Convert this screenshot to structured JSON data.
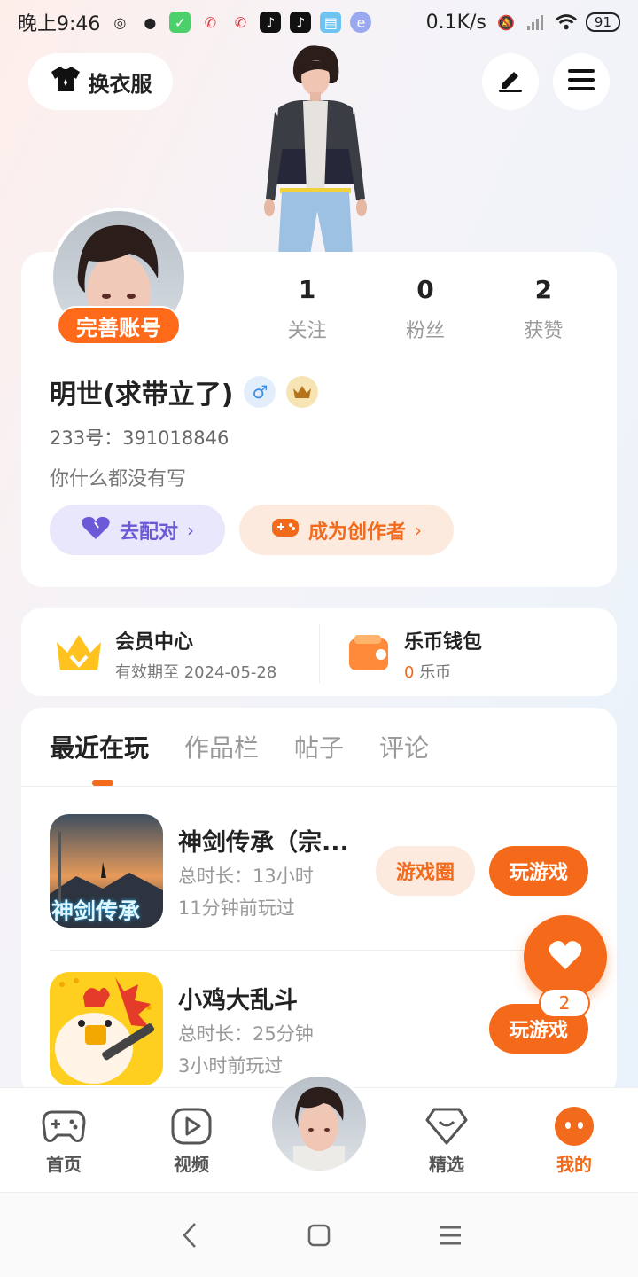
{
  "status_bar": {
    "time": "晚上9:46",
    "net_speed": "0.1K/s",
    "battery": "91"
  },
  "header": {
    "outfit_label": "换衣服"
  },
  "profile": {
    "complete_badge": "完善账号",
    "stats": [
      {
        "num": "1",
        "label": "关注"
      },
      {
        "num": "0",
        "label": "粉丝"
      },
      {
        "num": "2",
        "label": "获赞"
      }
    ],
    "username": "明世(求带立了)",
    "gender_symbol": "♂",
    "uid": "233号：391018846",
    "bio": "你什么都没有写",
    "match_label": "去配对",
    "creator_label": "成为创作者"
  },
  "vip": {
    "title": "会员中心",
    "subtitle": "有效期至 2024-05-28",
    "wallet_title": "乐币钱包",
    "wallet_amount": "0",
    "wallet_unit": "乐币"
  },
  "tabs": [
    "最近在玩",
    "作品栏",
    "帖子",
    "评论"
  ],
  "games": [
    {
      "name": "神剑传承（宗...",
      "duration": "总时长：13小时",
      "last_played": "11分钟前玩过",
      "icon_text": "神剑传承",
      "circle_label": "游戏圈",
      "play_label": "玩游戏"
    },
    {
      "name": "小鸡大乱斗",
      "duration": "总时长：25分钟",
      "last_played": "3小时前玩过",
      "play_label": "玩游戏"
    }
  ],
  "fab": {
    "count": "2"
  },
  "bottom_nav": [
    {
      "label": "首页",
      "icon": "gamepad-icon"
    },
    {
      "label": "视频",
      "icon": "play-icon"
    },
    {
      "label": "精选",
      "icon": "heart-box-icon"
    },
    {
      "label": "我的",
      "icon": "face-icon"
    }
  ],
  "colors": {
    "accent": "#f26a1b",
    "match_purple": "#6a5ad8"
  }
}
